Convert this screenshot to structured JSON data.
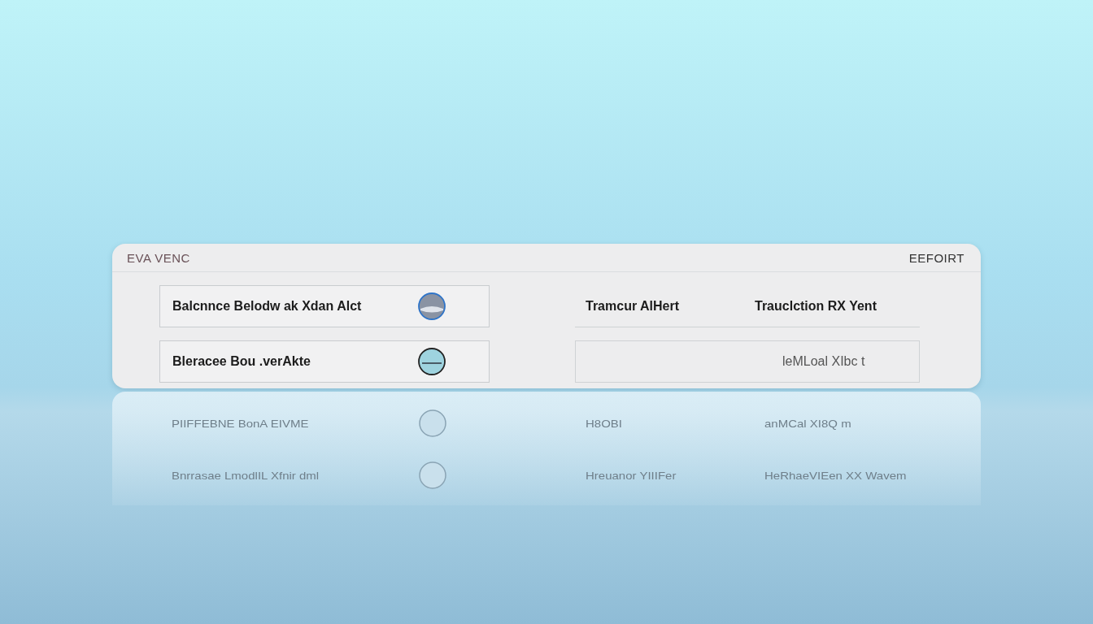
{
  "panel": {
    "brand": "EVA VENC",
    "action": "EEFOIRT",
    "left_rows": [
      {
        "label": "Balcnnce Belodw ak Xdan Alct",
        "kind": "toggle",
        "on": true
      },
      {
        "label": "Bleracee Bou .verAkte",
        "kind": "toggle",
        "on": false
      }
    ],
    "right_rows": [
      {
        "cells": [
          "Tramcur AlHert",
          "Trauclction RX Yent"
        ]
      },
      {
        "cells": [
          "leMLoal XIbc t"
        ]
      }
    ]
  },
  "reflection": {
    "left": [
      "PIIFFEBNE BonA EIVME",
      "Bnrrasae LmodlIL Xfnir dml"
    ],
    "right": [
      [
        "H8OBI",
        "anMCal XI8Q m"
      ],
      [
        "Hreuanor YIIIFer",
        "HeRhaeVIEen XX Wavem"
      ]
    ]
  }
}
